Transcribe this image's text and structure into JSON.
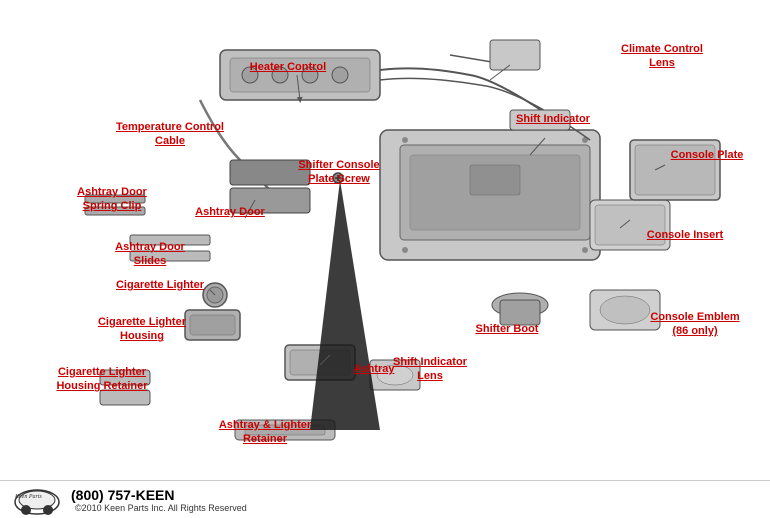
{
  "labels": {
    "climate_control_lens": "Climate\nControl Lens",
    "heater_control": "Heater Control",
    "shift_indicator": "Shift Indicator",
    "console_plate": "Console Plate",
    "temperature_control_cable": "Temperature\nControl Cable",
    "shifter_console_plate_screw": "Shifter\nConsole Plate\nScrew",
    "ashtray_door": "Ashtray\nDoor",
    "ashtray_door_spring_clip": "Ashtray Door\nSpring Clip",
    "ashtray_door_slides": "Ashtray Door\nSlides",
    "console_insert": "Console Insert",
    "cigarette_lighter": "Cigarette\nLighter",
    "cigarette_lighter_housing": "Cigarette Lighter\nHousing",
    "console_emblem": "Console\nEmblem\n(86 only)",
    "ashtray": "Ashtray",
    "shift_indicator_lens": "Shift\nIndicator\nLens",
    "shifter_boot": "Shifter\nBoot",
    "cigarette_lighter_housing_retainer": "Cigarette\nLighter\nHousing\nRetainer",
    "ashtray_lighter_retainer": "Ashtray &\nLighter\nRetainer"
  },
  "footer": {
    "logo": "Keen Parts",
    "phone": "(800) 757-KEEN",
    "copyright": "©2010 Keen Parts Inc. All Rights Reserved"
  }
}
